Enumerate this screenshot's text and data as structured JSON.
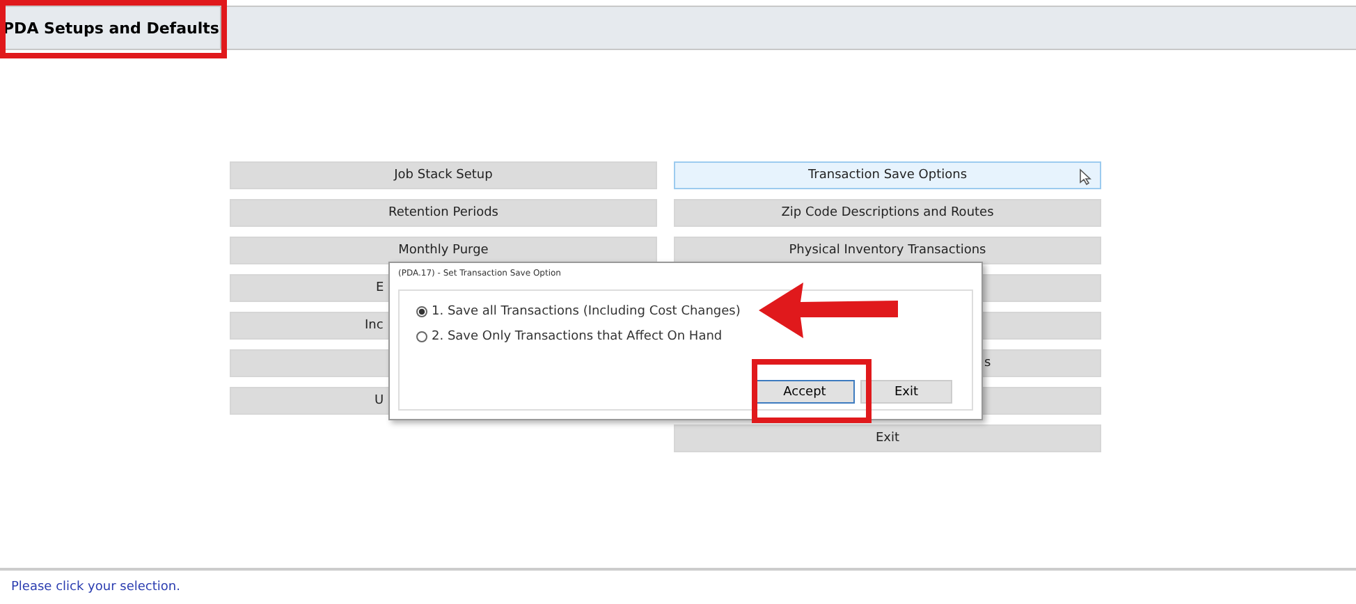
{
  "window": {
    "title": "PDA Setups and Defaults"
  },
  "left_buttons": [
    {
      "label": "Job Stack Setup",
      "kind": "full",
      "hovered": false
    },
    {
      "label": "Retention Periods",
      "kind": "full",
      "hovered": false
    },
    {
      "label": "Monthly Purge",
      "kind": "full",
      "hovered": false
    },
    {
      "label": "E",
      "kind": "covered",
      "hovered": false
    },
    {
      "label": "Inc",
      "kind": "covered",
      "hovered": false
    },
    {
      "kind": "covered",
      "hovered": false
    },
    {
      "label": "U",
      "kind": "covered",
      "hovered": false
    }
  ],
  "right_buttons": [
    {
      "label": "Transaction Save Options",
      "kind": "full",
      "hovered": true
    },
    {
      "label": "Zip Code Descriptions and Routes",
      "kind": "full",
      "hovered": false
    },
    {
      "label": "Physical Inventory Transactions",
      "kind": "full",
      "hovered": false
    },
    {
      "kind": "covered",
      "hovered": false
    },
    {
      "kind": "covered",
      "hovered": false
    },
    {
      "label": "s",
      "kind": "covered",
      "hovered": false
    },
    {
      "kind": "covered",
      "hovered": false
    },
    {
      "label": "Exit",
      "kind": "full",
      "hovered": false
    }
  ],
  "dialog": {
    "title": "(PDA.17) - Set Transaction Save Option",
    "options": [
      {
        "label": "1. Save all Transactions (Including Cost Changes)",
        "selected": true
      },
      {
        "label": "2. Save Only Transactions that Affect On Hand",
        "selected": false
      }
    ],
    "buttons": [
      "Accept",
      "Exit"
    ]
  },
  "status_bar": {
    "text": "Please click your selection."
  }
}
